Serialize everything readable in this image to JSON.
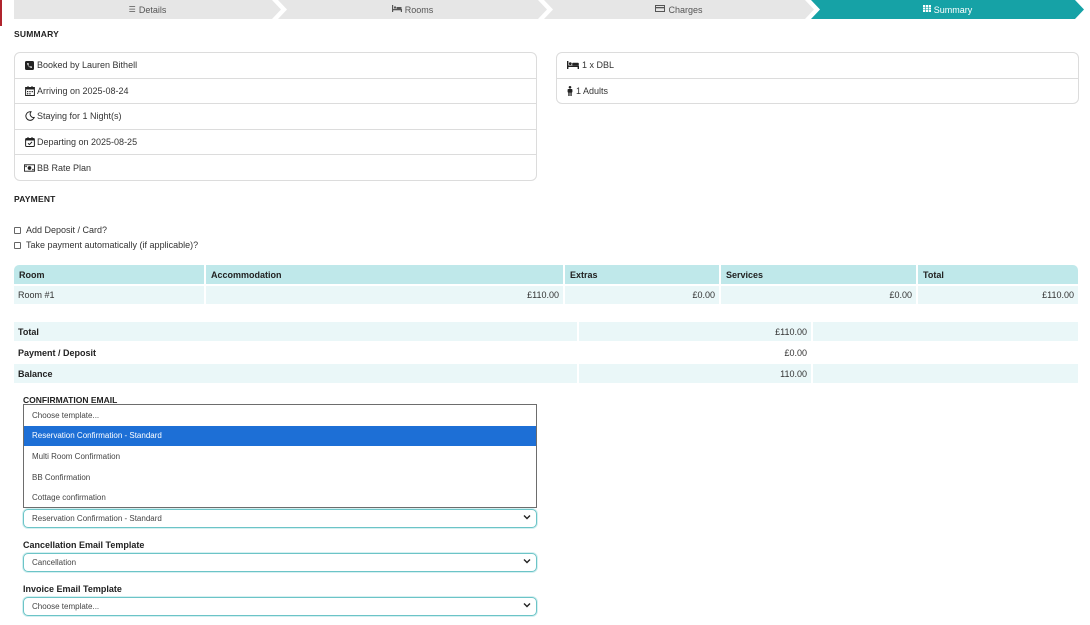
{
  "wizard": {
    "steps": [
      {
        "label": "Details",
        "icon": "list-icon"
      },
      {
        "label": "Rooms",
        "icon": "bed-icon"
      },
      {
        "label": "Charges",
        "icon": "credit-card-icon"
      },
      {
        "label": "Summary",
        "icon": "table-icon"
      }
    ],
    "active_step": "Summary",
    "active_color": "#16a2a6",
    "accent_color": "#b0242d"
  },
  "summary": {
    "title": "SUMMARY",
    "booking_details": [
      {
        "icon": "phone-icon",
        "text": "Booked by Lauren Bithell"
      },
      {
        "icon": "calendar-icon",
        "text": "Arriving on 2025-08-24"
      },
      {
        "icon": "moon-icon",
        "text": "Staying for 1 Night(s)"
      },
      {
        "icon": "calendar-check-icon",
        "text": "Departing on 2025-08-25"
      },
      {
        "icon": "money-icon",
        "text": "BB Rate Plan"
      }
    ],
    "room_details": [
      {
        "icon": "bed-icon",
        "text": "1 x DBL"
      },
      {
        "icon": "person-icon",
        "text": "1 Adults"
      }
    ]
  },
  "payment": {
    "title": "PAYMENT",
    "options": [
      {
        "label": "Add Deposit / Card?",
        "checked": false
      },
      {
        "label": "Take payment automatically (if applicable)?",
        "checked": false
      }
    ],
    "table": {
      "headers": [
        "Room",
        "Accommodation",
        "Extras",
        "Services",
        "Total"
      ],
      "rows": [
        [
          "Room #1",
          "£110.00",
          "£0.00",
          "£0.00",
          "£110.00"
        ]
      ]
    },
    "totals": [
      {
        "label": "Total",
        "value": "£110.00"
      },
      {
        "label": "Payment / Deposit",
        "value": "£0.00"
      },
      {
        "label": "Balance",
        "value": "110.00"
      }
    ]
  },
  "emails": {
    "confirmation": {
      "label": "CONFIRMATION EMAIL",
      "options": [
        "Choose template...",
        "Reservation Confirmation - Standard",
        "Multi Room Confirmation",
        "BB Confirmation",
        "Cottage confirmation"
      ],
      "highlighted": "Reservation Confirmation - Standard",
      "selected": "Reservation Confirmation - Standard"
    },
    "cancellation": {
      "label": "Cancellation Email Template",
      "selected": "Cancellation"
    },
    "invoice": {
      "label": "Invoice Email Template",
      "selected": "Choose template..."
    }
  }
}
